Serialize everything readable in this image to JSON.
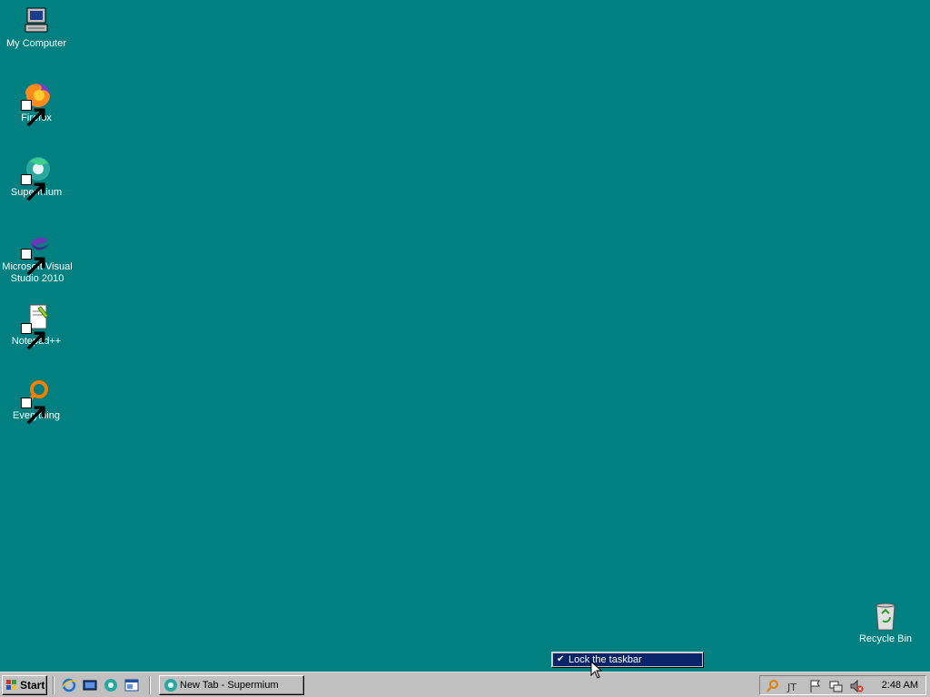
{
  "desktop": {
    "icons": [
      {
        "label": "My Computer",
        "icon": "computer-icon"
      },
      {
        "label": "Firefox",
        "icon": "firefox-icon"
      },
      {
        "label": "Supermium",
        "icon": "supermium-icon"
      },
      {
        "label": "Microsoft Visual Studio 2010",
        "icon": "visual-studio-icon"
      },
      {
        "label": "Notepad++",
        "icon": "notepadpp-icon"
      },
      {
        "label": "Everything",
        "icon": "everything-icon"
      },
      {
        "label": "Recycle Bin",
        "icon": "recycle-bin-icon"
      }
    ],
    "background": "#008080"
  },
  "context_menu": {
    "item": "Lock the taskbar",
    "checked": true,
    "highlight": "#0a246a"
  },
  "taskbar": {
    "start_label": "Start",
    "quick_launch": [
      "internet-explorer-icon",
      "show-desktop-icon",
      "supermium-icon",
      "explorer-icon"
    ],
    "task_button": "New Tab - Supermium",
    "tray_icons": [
      "search-icon",
      "ime-icon",
      "flag-icon",
      "network-icon",
      "volume-muted-icon"
    ],
    "clock": "2:48 AM"
  }
}
